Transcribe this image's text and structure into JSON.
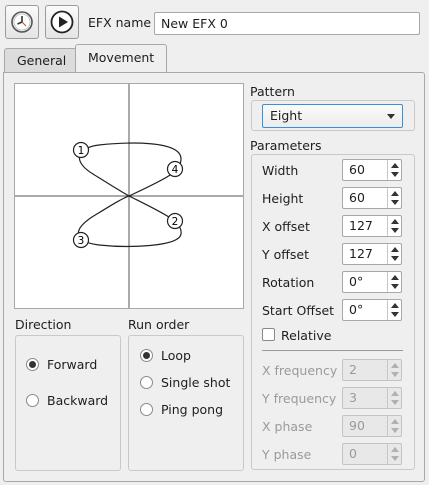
{
  "toolbar": {
    "clock_icon": "clock-icon",
    "play_icon": "play-icon",
    "efx_name_label": "EFX name",
    "efx_name_value": "New EFX 0"
  },
  "tabs": [
    {
      "label": "General",
      "active": false
    },
    {
      "label": "Movement",
      "active": true
    }
  ],
  "direction": {
    "title": "Direction",
    "options": [
      {
        "label": "Forward",
        "selected": true
      },
      {
        "label": "Backward",
        "selected": false
      }
    ]
  },
  "run_order": {
    "title": "Run order",
    "options": [
      {
        "label": "Loop",
        "selected": true
      },
      {
        "label": "Single shot",
        "selected": false
      },
      {
        "label": "Ping pong",
        "selected": false
      }
    ]
  },
  "pattern": {
    "title": "Pattern",
    "selected": "Eight"
  },
  "parameters": {
    "title": "Parameters",
    "width": {
      "label": "Width",
      "value": "60"
    },
    "height": {
      "label": "Height",
      "value": "60"
    },
    "x_offset": {
      "label": "X offset",
      "value": "127"
    },
    "y_offset": {
      "label": "Y offset",
      "value": "127"
    },
    "rotation": {
      "label": "Rotation",
      "value": "0°"
    },
    "start_offset": {
      "label": "Start Offset",
      "value": "0°"
    },
    "relative": {
      "label": "Relative",
      "checked": false
    },
    "x_frequency": {
      "label": "X frequency",
      "value": "2"
    },
    "y_frequency": {
      "label": "Y frequency",
      "value": "3"
    },
    "x_phase": {
      "label": "X phase",
      "value": "90"
    },
    "y_phase": {
      "label": "Y phase",
      "value": "0"
    }
  },
  "preview": {
    "markers": [
      "1",
      "2",
      "3",
      "4"
    ]
  }
}
